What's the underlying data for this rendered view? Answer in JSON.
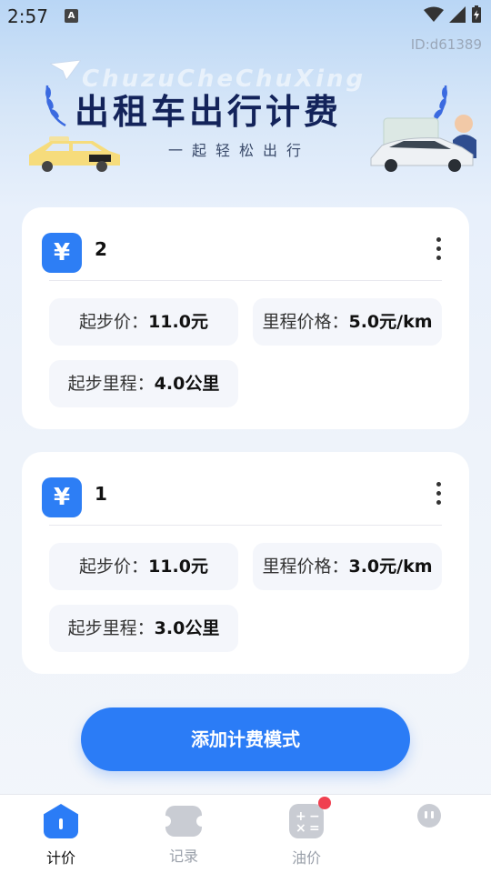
{
  "status_bar": {
    "time": "2:57",
    "notification_glyph": "A",
    "colors": {
      "icons": "#333333"
    }
  },
  "app_id": "ID:d61389",
  "banner": {
    "title": "出租车出行计费",
    "subtitle": "一起轻松出行",
    "ghost_text": "ChuzuCheChuXing"
  },
  "cards": [
    {
      "title": "2",
      "icon": "yen-icon",
      "fields": [
        {
          "label": "起步价：",
          "value": "11.0元"
        },
        {
          "label": "里程价格：",
          "value": "5.0元/km"
        },
        {
          "label": "起步里程：",
          "value": "4.0公里"
        }
      ]
    },
    {
      "title": "1",
      "icon": "yen-icon",
      "fields": [
        {
          "label": "起步价：",
          "value": "11.0元"
        },
        {
          "label": "里程价格：",
          "value": "3.0元/km"
        },
        {
          "label": "起步里程：",
          "value": "3.0公里"
        }
      ]
    }
  ],
  "add_button": {
    "label": "添加计费模式"
  },
  "tabs": [
    {
      "label": "计价",
      "icon": "home-icon",
      "active": true
    },
    {
      "label": "记录",
      "icon": "ticket-icon",
      "active": false
    },
    {
      "label": "油价",
      "icon": "calculator-icon",
      "active": false,
      "badge": true
    },
    {
      "label": "",
      "icon": "profile-icon",
      "active": false
    }
  ],
  "colors": {
    "accent": "#2b7cf6",
    "badge": "#f04050",
    "title": "#13235a"
  }
}
